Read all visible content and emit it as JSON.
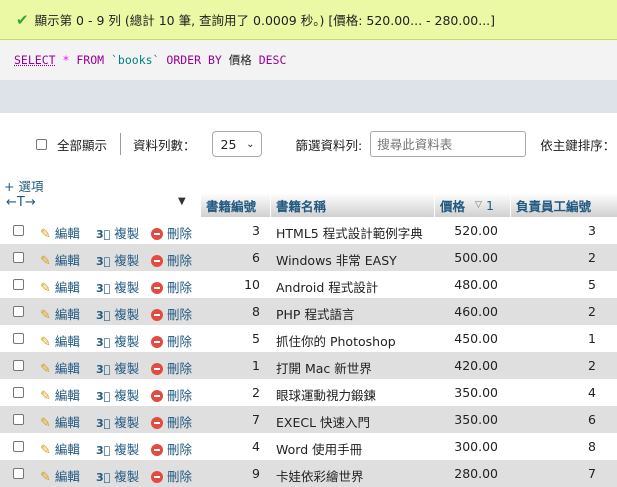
{
  "success_message": "顯示第 0 - 9 列 (總計 10 筆, 查詢用了 0.0009 秒。) [價格: 520.00... - 280.00...]",
  "sql": {
    "select": "SELECT",
    "star": "*",
    "from": "FROM",
    "table": "`books`",
    "order": "ORDER",
    "by": "BY",
    "column": "價格",
    "desc": "DESC"
  },
  "controls": {
    "show_all_label": "全部顯示",
    "rows_label": "資料列數：",
    "rows_value": "25",
    "filter_label": "篩選資料列:",
    "filter_placeholder": "搜尋此資料表",
    "sort_label": "依主鍵排序："
  },
  "options_link": "+ 選項",
  "arrows_label": "←T→",
  "columns": [
    "書籍編號",
    "書籍名稱",
    "價格",
    "負責員工編號"
  ],
  "sort_indicator": "1",
  "actions": {
    "edit": "編輯",
    "copy": "複製",
    "delete": "刪除"
  },
  "rows": [
    {
      "id": "3",
      "name": "HTML5 程式設計範例字典",
      "price": "520.00",
      "emp": "3"
    },
    {
      "id": "6",
      "name": "Windows 非常 EASY",
      "price": "500.00",
      "emp": "2"
    },
    {
      "id": "10",
      "name": "Android 程式設計",
      "price": "480.00",
      "emp": "5"
    },
    {
      "id": "8",
      "name": "PHP 程式語言",
      "price": "460.00",
      "emp": "2"
    },
    {
      "id": "5",
      "name": "抓住你的 Photoshop",
      "price": "450.00",
      "emp": "1"
    },
    {
      "id": "1",
      "name": "打開 Mac 新世界",
      "price": "420.00",
      "emp": "2"
    },
    {
      "id": "2",
      "name": "眼球運動視力鍛鍊",
      "price": "350.00",
      "emp": "4"
    },
    {
      "id": "7",
      "name": "EXECL 快速入門",
      "price": "350.00",
      "emp": "6"
    },
    {
      "id": "4",
      "name": "Word 使用手冊",
      "price": "300.00",
      "emp": "8"
    },
    {
      "id": "9",
      "name": "卡娃依彩繪世界",
      "price": "280.00",
      "emp": "7"
    }
  ]
}
